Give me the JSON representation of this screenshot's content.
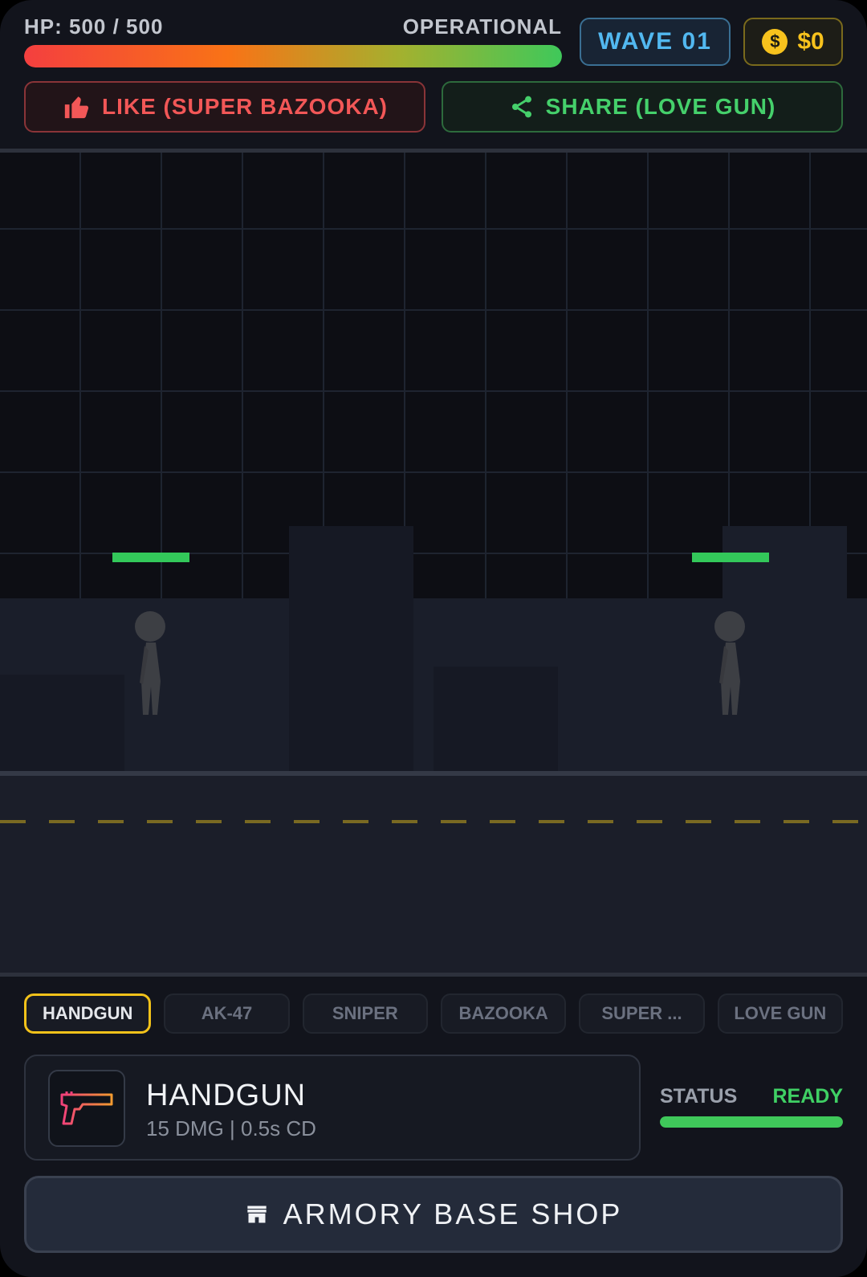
{
  "hud": {
    "hp_text": "HP: 500 / 500",
    "hp_fraction": 1.0,
    "status_text": "OPERATIONAL",
    "wave_text": "WAVE 01",
    "money_text": "$0",
    "coin_symbol": "$"
  },
  "actions": {
    "like_label": "LIKE (SUPER BAZOOKA)",
    "like_icon": "thumbs-up-icon",
    "share_label": "SHARE (LOVE GUN)",
    "share_icon": "share-icon"
  },
  "scene": {
    "enemies": [
      {
        "hp_fraction": 1.0
      },
      {
        "hp_fraction": 1.0
      }
    ]
  },
  "weapons": {
    "tabs": [
      "HANDGUN",
      "AK-47",
      "SNIPER",
      "BAZOOKA",
      "SUPER ...",
      "LOVE GUN"
    ],
    "active_index": 0
  },
  "current_weapon": {
    "name": "HANDGUN",
    "stats": "15 DMG | 0.5s CD",
    "icon": "pistol-icon",
    "status_label": "STATUS",
    "status_value": "READY",
    "ready_fraction": 1.0
  },
  "shop": {
    "label": "ARMORY BASE SHOP",
    "icon": "store-icon"
  },
  "colors": {
    "accent_gold": "#f2c21a",
    "ready_green": "#3fd064",
    "wave_blue": "#52b8f0",
    "like_red": "#f25757"
  }
}
